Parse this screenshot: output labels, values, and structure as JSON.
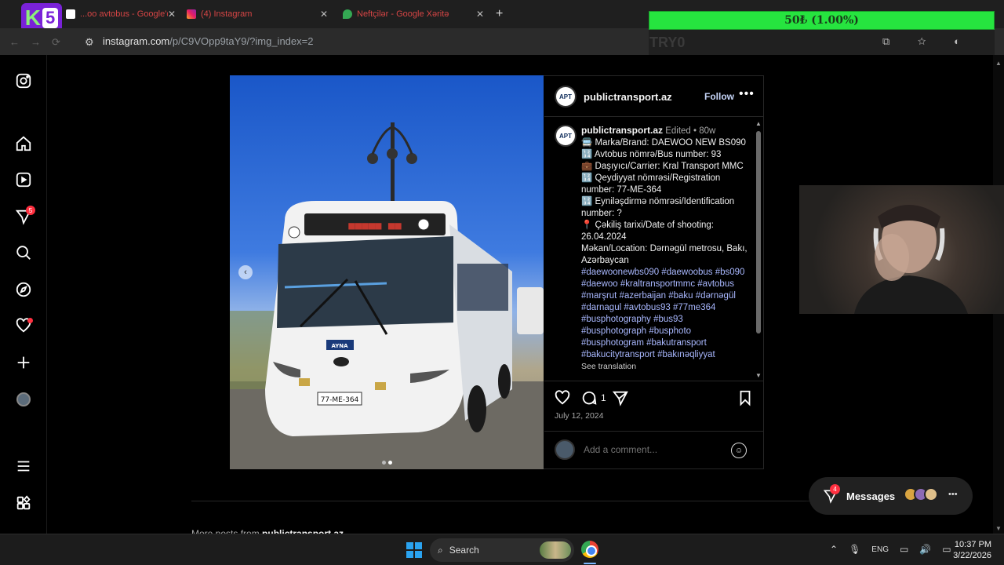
{
  "browser": {
    "tabs": [
      {
        "label": "...oo avtobus - Google'da a..."
      },
      {
        "label": "(4) Instagram"
      },
      {
        "label": "Neftçilər - Google Xəritə"
      }
    ],
    "url_host": "instagram.com",
    "url_path": "/p/C9VOpp9taY9/?img_index=2"
  },
  "stream_overlay": {
    "logo_k": "K",
    "logo_n": "5",
    "donation_text": "50₺ (1.00%)",
    "faded_label": "TRY0"
  },
  "sidebar": {
    "notifications_badge": "5"
  },
  "post": {
    "author": "publictransport.az",
    "avatar_text": "APT",
    "follow_label": "Follow",
    "more_label": "•••",
    "caption_meta": "Edited • 80w",
    "caption_lines": [
      "🚍 Marka/Brand: DAEWOO NEW BS090",
      "🔢 Avtobus nömrə/Bus number: 93",
      "💼 Daşıyıcı/Carrier: Kral Transport MMC",
      "🔢 Qeydiyyat nömrəsi/Registration number: 77-ME-364",
      "🔢 Eyniləşdirmə nömrəsi/Identification number: ?",
      "📍 Çəkiliş tarixi/Date of shooting: 26.04.2024",
      "Məkan/Location: Dərnəgül metrosu, Bakı, Azərbaycan"
    ],
    "hashtags": "#daewoonewbs090 #daewoobus #bs090 #daewoo #kraltransportmmc #avtobus #marşrut #azerbaijan #baku #dərnəgül #darnagul #avtobus93 #77me364 #busphotography #bus93 #busphotograph #busphoto #busphotogram #bakutransport #bakucitytransport #bakınəqliyyat",
    "see_translation": "See translation",
    "comment_count": "1",
    "date": "July 12, 2024",
    "comment_placeholder": "Add a comment...",
    "image_count": 2,
    "image_index": 2,
    "bus_plate": "77-ME-364",
    "bus_badge": "AYNA"
  },
  "footer": {
    "more_posts_prefix": "More posts from",
    "more_posts_user": "publictransport.az"
  },
  "messages": {
    "label": "Messages",
    "badge": "4"
  },
  "taskbar": {
    "search_label": "Search",
    "language": "ENG",
    "time": "10:37 PM",
    "date": "3/22/2026"
  },
  "colors": {
    "ig_link": "#a9b8ff",
    "donation_green": "#26e43f",
    "notif_red": "#ff3040"
  }
}
